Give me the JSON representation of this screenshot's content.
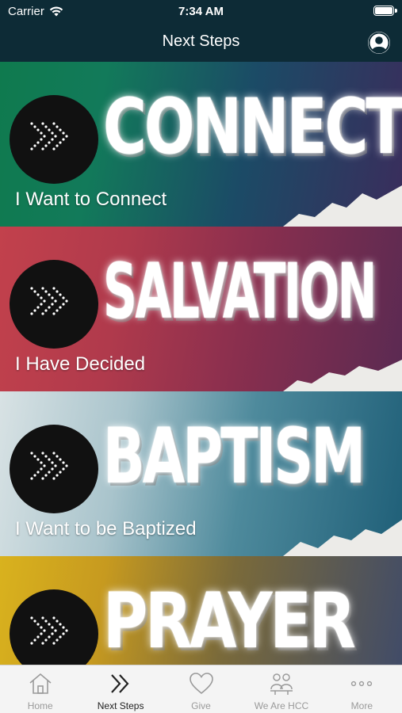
{
  "status_bar": {
    "carrier": "Carrier",
    "time": "7:34 AM"
  },
  "nav": {
    "title": "Next Steps"
  },
  "cards": [
    {
      "headline": "CONNECT",
      "subtitle": "I Want to Connect"
    },
    {
      "headline": "SALVATION",
      "subtitle": "I Have Decided"
    },
    {
      "headline": "BAPTISM",
      "subtitle": "I Want to be Baptized"
    },
    {
      "headline": "PRAYER",
      "subtitle": ""
    }
  ],
  "tabs": [
    {
      "label": "Home",
      "icon": "home-icon"
    },
    {
      "label": "Next Steps",
      "icon": "chevrons-icon",
      "active": true
    },
    {
      "label": "Give",
      "icon": "heart-icon"
    },
    {
      "label": "We Are HCC",
      "icon": "people-icon"
    },
    {
      "label": "More",
      "icon": "more-icon"
    }
  ],
  "colors": {
    "header": "#0d2b36",
    "tabbar": "#f4f4f4",
    "active_tab": "#222222",
    "inactive_tab": "#9a9a9a"
  }
}
